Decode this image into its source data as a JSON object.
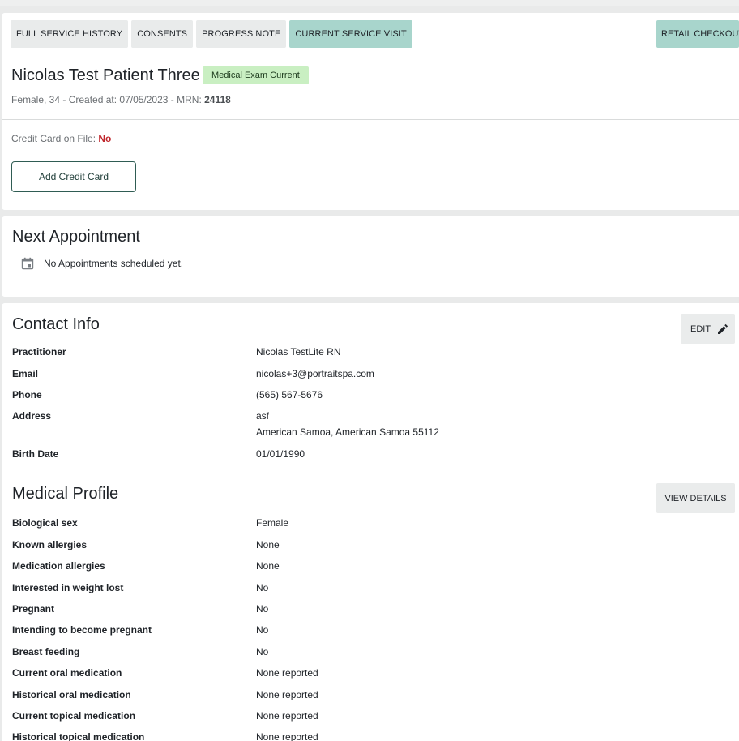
{
  "tabs": [
    {
      "label": "FULL SERVICE HISTORY"
    },
    {
      "label": "CONSENTS"
    },
    {
      "label": "PROGRESS NOTE"
    },
    {
      "label": "CURRENT SERVICE VISIT"
    }
  ],
  "retail_checkout_label": "RETAIL CHECKOUT",
  "patient": {
    "name": "Nicolas Test Patient Three",
    "badge": "Medical Exam Current",
    "meta_prefix": "Female, 34 - Created at: 07/05/2023 - MRN: ",
    "mrn": "24118"
  },
  "credit_card": {
    "label": "Credit Card on File: ",
    "value": "No",
    "add_button": "Add Credit Card"
  },
  "next_appointment": {
    "title": "Next Appointment",
    "empty_text": "No Appointments scheduled yet."
  },
  "contact_info": {
    "title": "Contact Info",
    "edit_label": "EDIT",
    "practitioner_label": "Practitioner",
    "practitioner": "Nicolas TestLite RN",
    "email_label": "Email",
    "email": "nicolas+3@portraitspa.com",
    "phone_label": "Phone",
    "phone": "(565) 567-5676",
    "address_label": "Address",
    "address_line1": "asf",
    "address_line2": "American Samoa, American Samoa 55112",
    "birth_date_label": "Birth Date",
    "birth_date": "01/01/1990"
  },
  "medical_profile": {
    "title": "Medical Profile",
    "view_details_label": "VIEW DETAILS",
    "rows": [
      {
        "label": "Biological sex",
        "value": "Female"
      },
      {
        "label": "Known allergies",
        "value": "None"
      },
      {
        "label": "Medication allergies",
        "value": "None"
      },
      {
        "label": "Interested in weight lost",
        "value": "No"
      },
      {
        "label": "Pregnant",
        "value": "No"
      },
      {
        "label": "Intending to become pregnant",
        "value": "No"
      },
      {
        "label": "Breast feeding",
        "value": "No"
      },
      {
        "label": "Current oral medication",
        "value": "None reported"
      },
      {
        "label": "Historical oral medication",
        "value": "None reported"
      },
      {
        "label": "Current topical medication",
        "value": "None reported"
      },
      {
        "label": "Historical topical medication",
        "value": "None reported"
      }
    ]
  },
  "colors": {
    "accent": "#a8d5cc",
    "badge_bg": "#c9efc2",
    "alert_red": "#c0272d",
    "button_border": "#2f5c53"
  },
  "icons": [
    "calendar-icon",
    "pencil-icon"
  ]
}
